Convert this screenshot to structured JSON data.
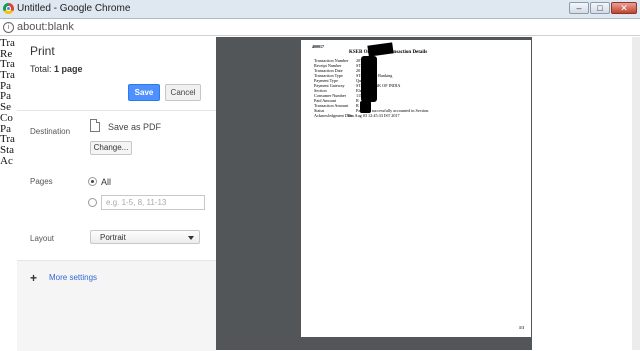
{
  "window": {
    "title": "Untitled - Google Chrome",
    "min": "–",
    "max": "□",
    "close": "✕"
  },
  "address": {
    "url": "about:blank",
    "icon": "info-icon"
  },
  "background_lines": [
    "Tra",
    "Re",
    "Tra",
    "Tra",
    "Pa",
    "Pa",
    "Se",
    "Co",
    "Pa",
    "Tra",
    "Sta",
    "Ac"
  ],
  "print": {
    "title": "Print",
    "total_prefix": "Total:",
    "total_value": "1 page",
    "save_label": "Save",
    "cancel_label": "Cancel",
    "destination_label": "Destination",
    "destination_value": "Save as PDF",
    "change_label": "Change...",
    "pages_label": "Pages",
    "pages_all": "All",
    "pages_placeholder": "e.g. 1-5, 8, 11-13",
    "layout_label": "Layout",
    "layout_value": "Portrait",
    "more_settings": "More settings"
  },
  "preview": {
    "code": "400017",
    "title": "KSEB Online P        , Transaction Details",
    "rows": [
      {
        "k": "Transaction Number",
        "v": "207"
      },
      {
        "k": "Receipt Number",
        "v": "STA"
      },
      {
        "k": "Transaction Date",
        "v": "201"
      },
      {
        "k": "Transaction Type",
        "v": "STAT                                  Direct Banking"
      },
      {
        "k": "Payment Type",
        "v": "Quick Pay"
      },
      {
        "k": "Payment Gateway",
        "v": "STATE BANK OF INDIA"
      },
      {
        "k": "Section",
        "v": "Electr"
      },
      {
        "k": "Consumer Number",
        "v": "1156"
      },
      {
        "k": "Paid Amount",
        "v": "R"
      },
      {
        "k": "Transaction Amount",
        "v": "R 333.0"
      },
      {
        "k": "Status",
        "v": "Payment successfully accounted in Section."
      },
      {
        "k": "Acknowledgment Date",
        "v": "Thu Aug 03 12:45:33 IST 2017"
      }
    ],
    "page_number": "1/1"
  }
}
